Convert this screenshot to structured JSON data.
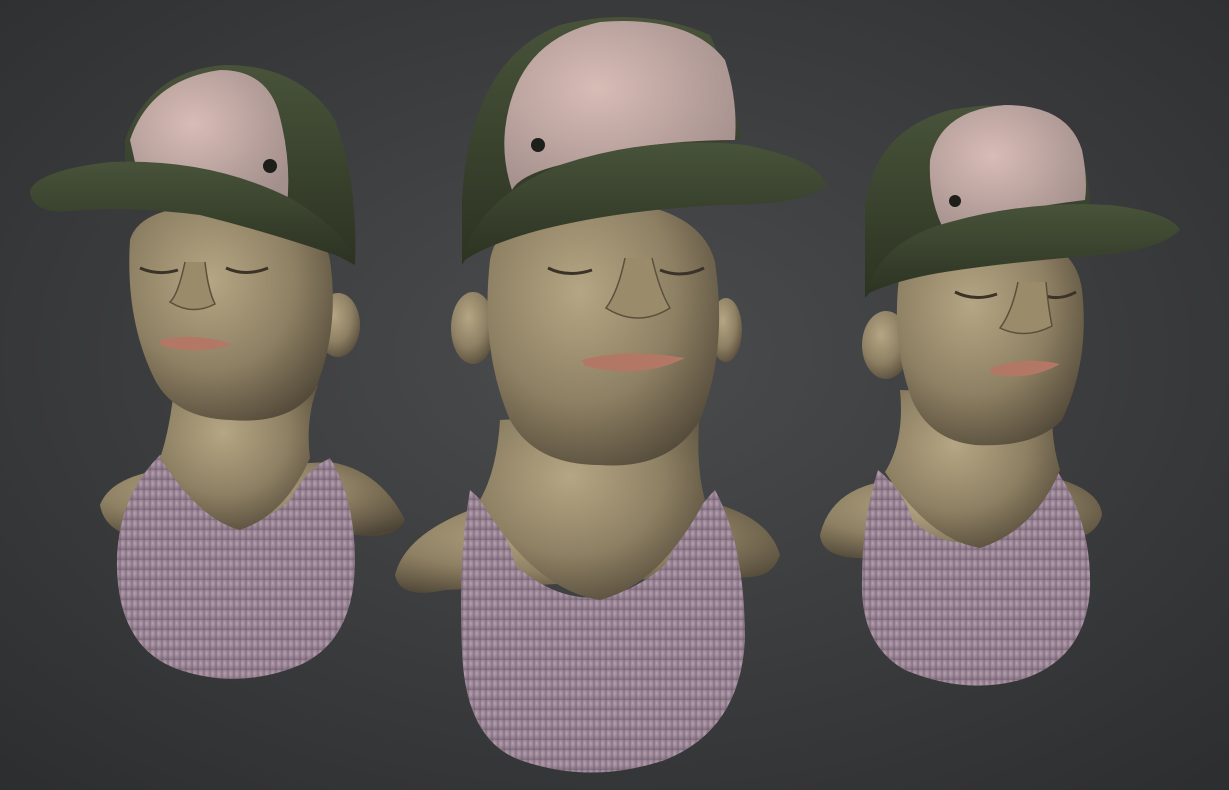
{
  "colors": {
    "bg_center": "#4b4c4e",
    "bg_edge": "#2c2d2f",
    "skin": "#8e8063",
    "skin_light": "#b5a684",
    "skin_shadow": "#4e4536",
    "cap_dark": "#2c3322",
    "cap_dark_light": "#48533a",
    "cap_panel": "#d8bcb6",
    "cap_panel_shadow": "#a38f8c",
    "tank_top": "#b7a1b1",
    "tank_top_shadow": "#7b6878",
    "lip": "#b27865"
  },
  "busts": [
    {
      "view": "three-quarter-left"
    },
    {
      "view": "front"
    },
    {
      "view": "three-quarter-right"
    }
  ]
}
